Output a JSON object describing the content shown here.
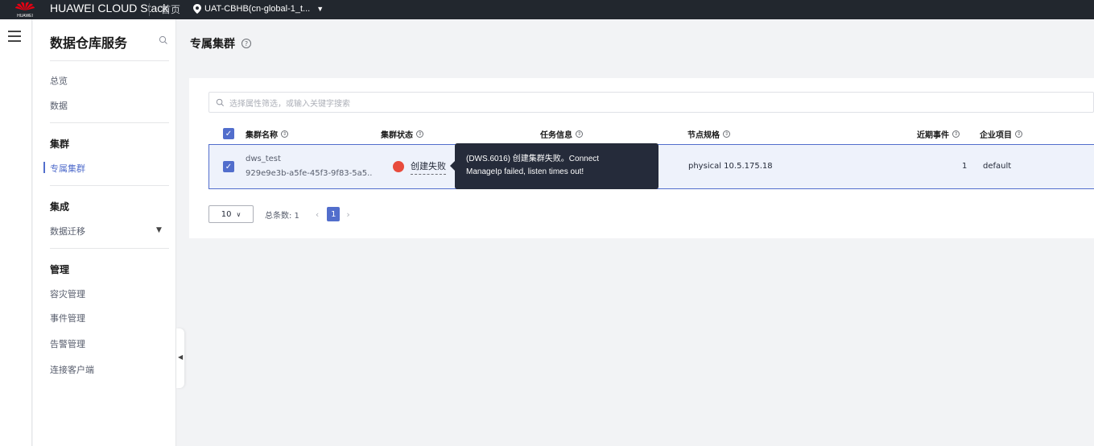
{
  "header": {
    "brand": "HUAWEI CLOUD Stack",
    "logo_text": "HUAWEI",
    "home": "首页",
    "region": "UAT-CBHB(cn-global-1_t...",
    "colors": {
      "bar": "#22272e",
      "logo_red": "#e60012"
    }
  },
  "sidebar": {
    "title": "数据仓库服务",
    "overview": "总览",
    "data": "数据",
    "group_cluster": "集群",
    "dedicated_cluster": "专属集群",
    "group_integration": "集成",
    "data_migration": "数据迁移",
    "group_manage": "管理",
    "dr_manage": "容灾管理",
    "event_manage": "事件管理",
    "alarm_manage": "告警管理",
    "client_connect": "连接客户端"
  },
  "main": {
    "page_title": "专属集群",
    "search_placeholder": "选择属性筛选，或输入关键字搜索",
    "columns": {
      "name": "集群名称",
      "status": "集群状态",
      "task": "任务信息",
      "node_spec": "节点规格",
      "recent_events": "近期事件",
      "enterprise_project": "企业项目"
    },
    "row": {
      "name": "dws_test",
      "id": "929e9e3b-a5fe-45f3-9f83-5a5..",
      "status": "创建失败",
      "node_spec": "physical 10.5.175.18",
      "recent_events": "1",
      "enterprise_project": "default"
    },
    "tooltip": {
      "line1": "(DWS.6016) 创建集群失败。Connect",
      "line2": "ManageIp failed, listen times out!"
    },
    "pager": {
      "page_size": "10",
      "total": "总条数: 1",
      "current_page": "1"
    },
    "colors": {
      "accent": "#526ecc",
      "error": "#e84b3c"
    }
  }
}
